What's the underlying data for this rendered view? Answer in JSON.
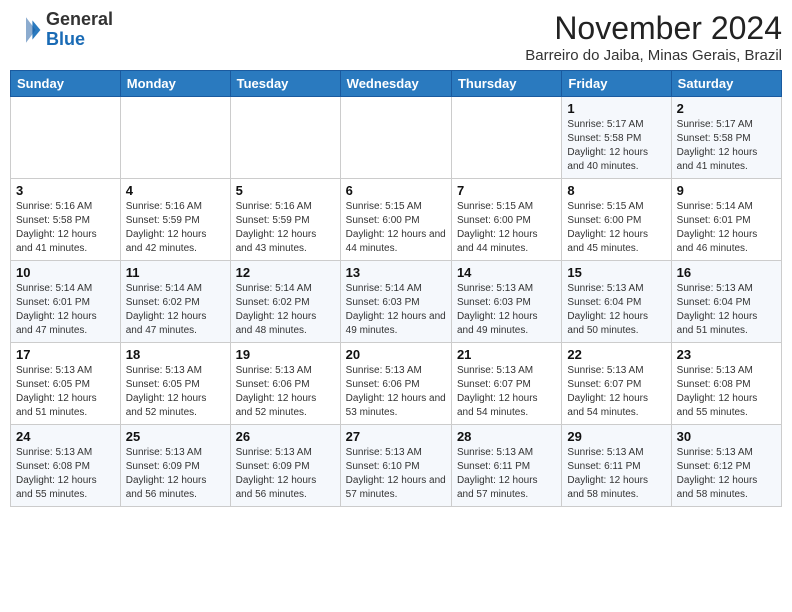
{
  "header": {
    "logo_line1": "General",
    "logo_line2": "Blue",
    "month_year": "November 2024",
    "location": "Barreiro do Jaiba, Minas Gerais, Brazil"
  },
  "days_of_week": [
    "Sunday",
    "Monday",
    "Tuesday",
    "Wednesday",
    "Thursday",
    "Friday",
    "Saturday"
  ],
  "weeks": [
    [
      {
        "day": "",
        "info": ""
      },
      {
        "day": "",
        "info": ""
      },
      {
        "day": "",
        "info": ""
      },
      {
        "day": "",
        "info": ""
      },
      {
        "day": "",
        "info": ""
      },
      {
        "day": "1",
        "info": "Sunrise: 5:17 AM\nSunset: 5:58 PM\nDaylight: 12 hours and 40 minutes."
      },
      {
        "day": "2",
        "info": "Sunrise: 5:17 AM\nSunset: 5:58 PM\nDaylight: 12 hours and 41 minutes."
      }
    ],
    [
      {
        "day": "3",
        "info": "Sunrise: 5:16 AM\nSunset: 5:58 PM\nDaylight: 12 hours and 41 minutes."
      },
      {
        "day": "4",
        "info": "Sunrise: 5:16 AM\nSunset: 5:59 PM\nDaylight: 12 hours and 42 minutes."
      },
      {
        "day": "5",
        "info": "Sunrise: 5:16 AM\nSunset: 5:59 PM\nDaylight: 12 hours and 43 minutes."
      },
      {
        "day": "6",
        "info": "Sunrise: 5:15 AM\nSunset: 6:00 PM\nDaylight: 12 hours and 44 minutes."
      },
      {
        "day": "7",
        "info": "Sunrise: 5:15 AM\nSunset: 6:00 PM\nDaylight: 12 hours and 44 minutes."
      },
      {
        "day": "8",
        "info": "Sunrise: 5:15 AM\nSunset: 6:00 PM\nDaylight: 12 hours and 45 minutes."
      },
      {
        "day": "9",
        "info": "Sunrise: 5:14 AM\nSunset: 6:01 PM\nDaylight: 12 hours and 46 minutes."
      }
    ],
    [
      {
        "day": "10",
        "info": "Sunrise: 5:14 AM\nSunset: 6:01 PM\nDaylight: 12 hours and 47 minutes."
      },
      {
        "day": "11",
        "info": "Sunrise: 5:14 AM\nSunset: 6:02 PM\nDaylight: 12 hours and 47 minutes."
      },
      {
        "day": "12",
        "info": "Sunrise: 5:14 AM\nSunset: 6:02 PM\nDaylight: 12 hours and 48 minutes."
      },
      {
        "day": "13",
        "info": "Sunrise: 5:14 AM\nSunset: 6:03 PM\nDaylight: 12 hours and 49 minutes."
      },
      {
        "day": "14",
        "info": "Sunrise: 5:13 AM\nSunset: 6:03 PM\nDaylight: 12 hours and 49 minutes."
      },
      {
        "day": "15",
        "info": "Sunrise: 5:13 AM\nSunset: 6:04 PM\nDaylight: 12 hours and 50 minutes."
      },
      {
        "day": "16",
        "info": "Sunrise: 5:13 AM\nSunset: 6:04 PM\nDaylight: 12 hours and 51 minutes."
      }
    ],
    [
      {
        "day": "17",
        "info": "Sunrise: 5:13 AM\nSunset: 6:05 PM\nDaylight: 12 hours and 51 minutes."
      },
      {
        "day": "18",
        "info": "Sunrise: 5:13 AM\nSunset: 6:05 PM\nDaylight: 12 hours and 52 minutes."
      },
      {
        "day": "19",
        "info": "Sunrise: 5:13 AM\nSunset: 6:06 PM\nDaylight: 12 hours and 52 minutes."
      },
      {
        "day": "20",
        "info": "Sunrise: 5:13 AM\nSunset: 6:06 PM\nDaylight: 12 hours and 53 minutes."
      },
      {
        "day": "21",
        "info": "Sunrise: 5:13 AM\nSunset: 6:07 PM\nDaylight: 12 hours and 54 minutes."
      },
      {
        "day": "22",
        "info": "Sunrise: 5:13 AM\nSunset: 6:07 PM\nDaylight: 12 hours and 54 minutes."
      },
      {
        "day": "23",
        "info": "Sunrise: 5:13 AM\nSunset: 6:08 PM\nDaylight: 12 hours and 55 minutes."
      }
    ],
    [
      {
        "day": "24",
        "info": "Sunrise: 5:13 AM\nSunset: 6:08 PM\nDaylight: 12 hours and 55 minutes."
      },
      {
        "day": "25",
        "info": "Sunrise: 5:13 AM\nSunset: 6:09 PM\nDaylight: 12 hours and 56 minutes."
      },
      {
        "day": "26",
        "info": "Sunrise: 5:13 AM\nSunset: 6:09 PM\nDaylight: 12 hours and 56 minutes."
      },
      {
        "day": "27",
        "info": "Sunrise: 5:13 AM\nSunset: 6:10 PM\nDaylight: 12 hours and 57 minutes."
      },
      {
        "day": "28",
        "info": "Sunrise: 5:13 AM\nSunset: 6:11 PM\nDaylight: 12 hours and 57 minutes."
      },
      {
        "day": "29",
        "info": "Sunrise: 5:13 AM\nSunset: 6:11 PM\nDaylight: 12 hours and 58 minutes."
      },
      {
        "day": "30",
        "info": "Sunrise: 5:13 AM\nSunset: 6:12 PM\nDaylight: 12 hours and 58 minutes."
      }
    ]
  ]
}
